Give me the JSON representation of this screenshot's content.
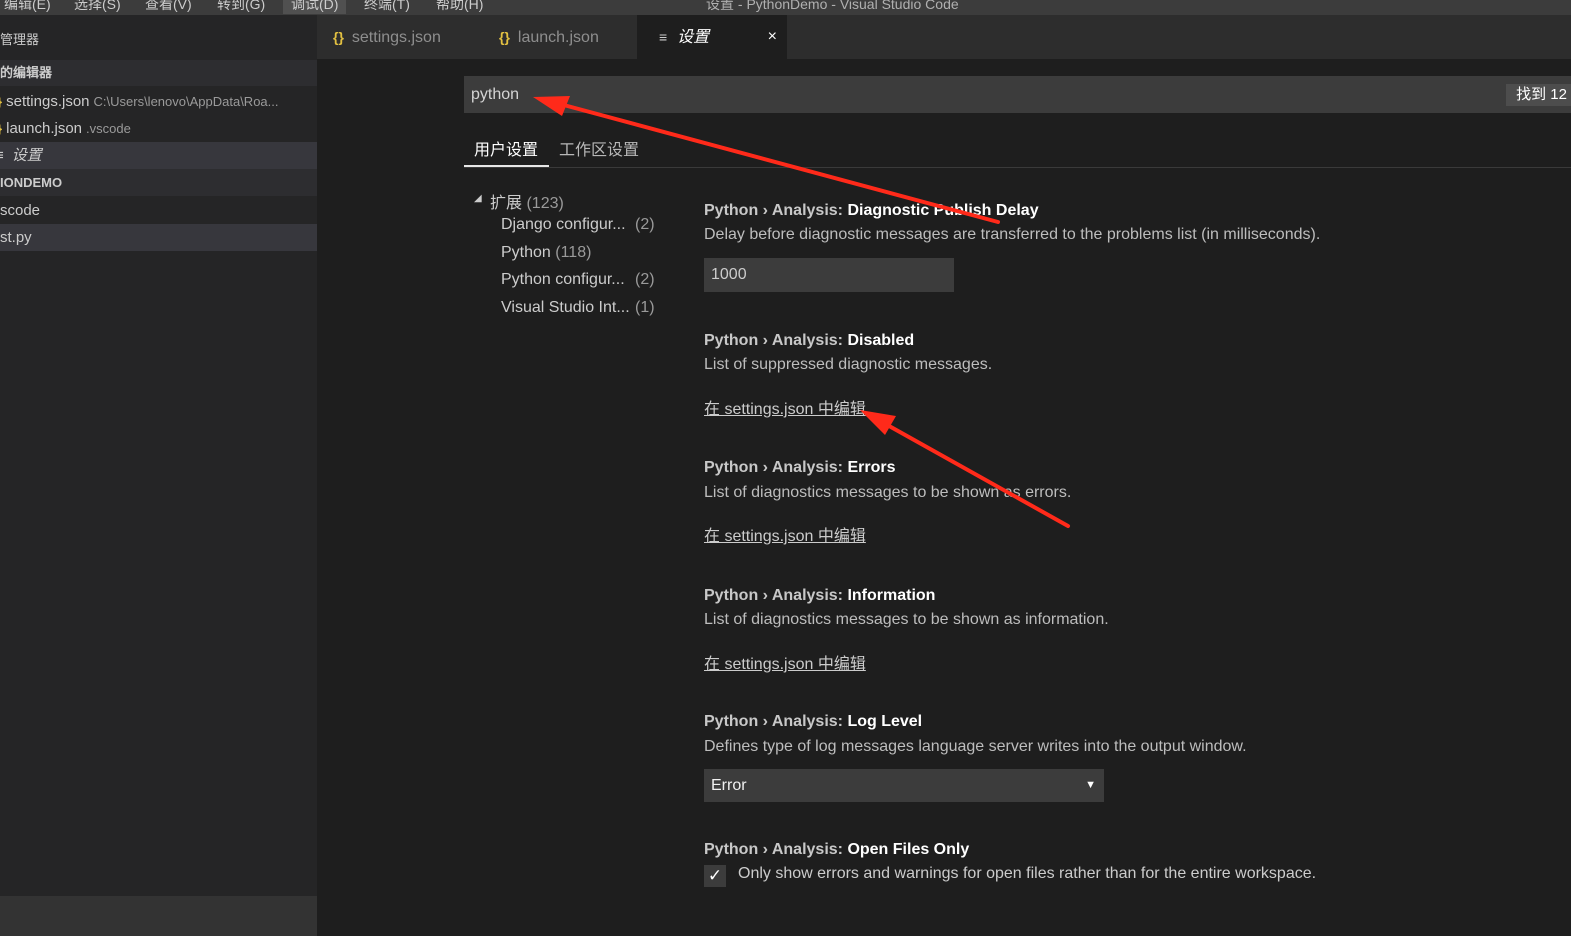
{
  "menubar": {
    "items": [
      "编辑(E)",
      "选择(S)",
      "查看(V)",
      "转到(G)",
      "调试(D)",
      "终端(T)",
      "帮助(H)"
    ],
    "window_title": "设置 - PythonDemo - Visual Studio Code"
  },
  "sidebar": {
    "explorer_title": "管理器",
    "open_editors_title": "的编辑器",
    "open_editors": [
      {
        "icon": "{}",
        "name": "settings.json",
        "desc": "C:\\Users\\lenovo\\AppData\\Roa..."
      },
      {
        "icon": "{}",
        "name": "launch.json",
        "desc": ".vscode"
      },
      {
        "icon": "≡",
        "name": "设置",
        "desc": ""
      }
    ],
    "project_title": "IONDEMO",
    "files": [
      "scode",
      "st.py"
    ]
  },
  "tabs": [
    {
      "icon": "{}",
      "label": "settings.json"
    },
    {
      "icon": "{}",
      "label": "launch.json"
    },
    {
      "icon": "≡",
      "label": "设置",
      "close": "×"
    }
  ],
  "search": {
    "value": "python",
    "result_count": "找到 12"
  },
  "scope_tabs": [
    "用户设置",
    "工作区设置"
  ],
  "toc": {
    "root": {
      "label": "扩展",
      "count": "(123)"
    },
    "items": [
      {
        "label": "Django configur...",
        "count": "(2)"
      },
      {
        "label": "Python",
        "count": "(118)"
      },
      {
        "label": "Python configur...",
        "count": "(2)"
      },
      {
        "label": "Visual Studio Int...",
        "count": "(1)"
      }
    ]
  },
  "settings": [
    {
      "category": "Python › Analysis: ",
      "key": "Diagnostic Publish Delay",
      "description": "Delay before diagnostic messages are transferred to the problems list (in milliseconds).",
      "value": "1000"
    },
    {
      "category": "Python › Analysis: ",
      "key": "Disabled",
      "description": "List of suppressed diagnostic messages.",
      "link": "在 settings.json 中编辑"
    },
    {
      "category": "Python › Analysis: ",
      "key": "Errors",
      "description": "List of diagnostics messages to be shown as errors.",
      "link": "在 settings.json 中编辑"
    },
    {
      "category": "Python › Analysis: ",
      "key": "Information",
      "description": "List of diagnostics messages to be shown as information.",
      "link": "在 settings.json 中编辑"
    },
    {
      "category": "Python › Analysis: ",
      "key": "Log Level",
      "description": "Defines type of log messages language server writes into the output window.",
      "selected": "Error",
      "arrow": "▼"
    },
    {
      "category": "Python › Analysis: ",
      "key": "Open Files Only",
      "description": "Only show errors and warnings for open files rather than for the entire workspace.",
      "checked": true,
      "checkmark": "✓"
    }
  ],
  "colors": {
    "annotation_arrow": "#ff2a1a",
    "json_icon": "#e2c041",
    "editor_bg": "#1e1e1e",
    "sidebar_bg": "#252526"
  }
}
